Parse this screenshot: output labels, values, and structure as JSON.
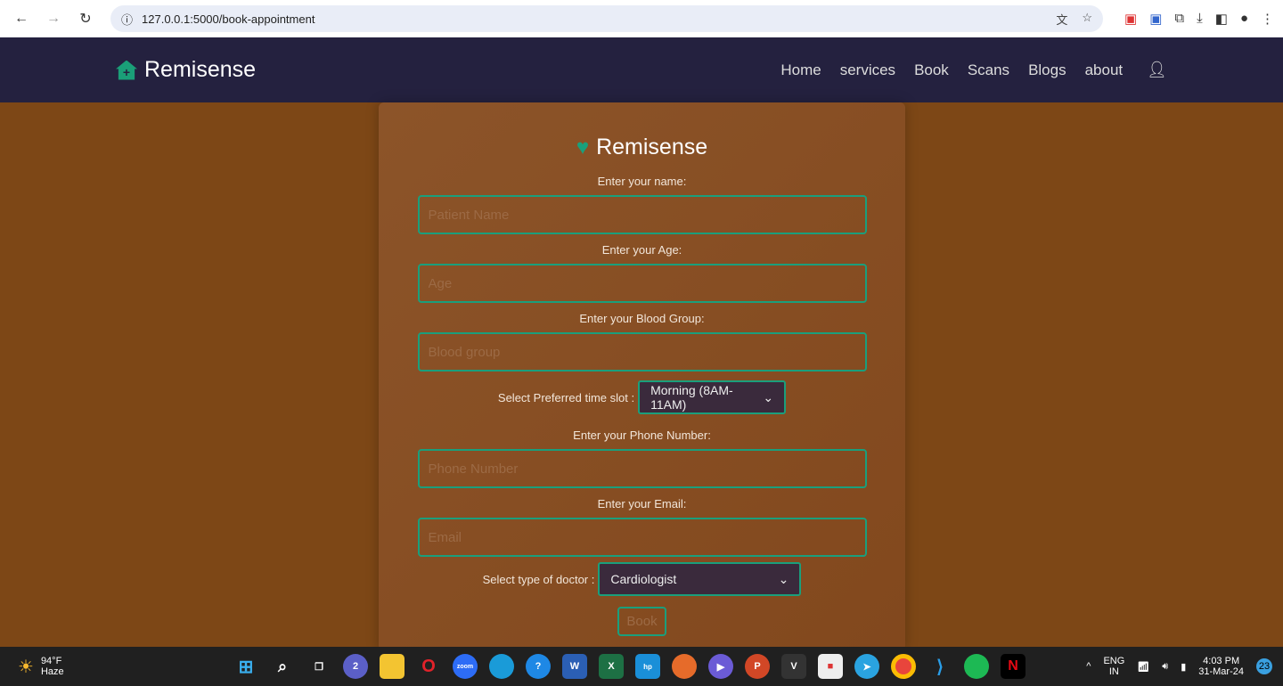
{
  "browser": {
    "url": "127.0.0.1:5000/book-appointment"
  },
  "nav": {
    "brand": "Remisense",
    "items": [
      "Home",
      "services",
      "Book",
      "Scans",
      "Blogs",
      "about"
    ]
  },
  "form": {
    "brand": "Remisense",
    "name_label": "Enter your name:",
    "name_placeholder": "Patient Name",
    "age_label": "Enter your Age:",
    "age_placeholder": "Age",
    "blood_label": "Enter your Blood Group:",
    "blood_placeholder": "Blood group",
    "slot_label": "Select Preferred time slot :",
    "slot_value": "Morning (8AM-11AM)",
    "phone_label": "Enter your Phone Number:",
    "phone_placeholder": "Phone Number",
    "email_label": "Enter your Email:",
    "email_placeholder": "Email",
    "doctor_label": "Select type of doctor :",
    "doctor_value": "Cardiologist",
    "book_label": "Book"
  },
  "taskbar": {
    "temp": "94°F",
    "weather": "Haze",
    "lang1": "ENG",
    "lang2": "IN",
    "time": "4:03 PM",
    "date": "31-Mar-24",
    "notif": "23",
    "teams_badge": "2"
  },
  "colors": {
    "accent": "#1a9f7c",
    "navbar": "#24213f",
    "background": "#7d4716"
  }
}
